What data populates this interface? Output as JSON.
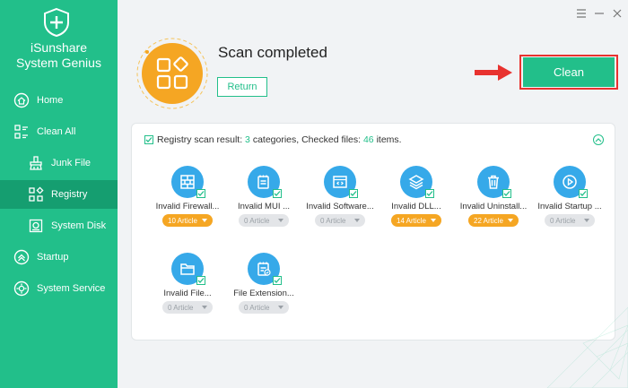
{
  "app": {
    "name_line1": "iSunshare",
    "name_line2": "System Genius"
  },
  "sidebar": {
    "items": [
      {
        "label": "Home",
        "icon": "home-icon"
      },
      {
        "label": "Clean All",
        "icon": "clean-all-icon"
      },
      {
        "label": "Junk File",
        "icon": "junk-file-icon"
      },
      {
        "label": "Registry",
        "icon": "registry-icon",
        "active": true
      },
      {
        "label": "System Disk",
        "icon": "system-disk-icon"
      },
      {
        "label": "Startup",
        "icon": "startup-icon"
      },
      {
        "label": "System Service",
        "icon": "system-service-icon"
      }
    ]
  },
  "header": {
    "title": "Scan completed",
    "return_label": "Return",
    "clean_label": "Clean"
  },
  "result": {
    "prefix": "Registry scan result:",
    "categories_count": "3",
    "categories_text": "categories, Checked files:",
    "files_count": "46",
    "files_text": "items."
  },
  "categories": [
    {
      "label": "Invalid Firewall...",
      "count": "10 Article",
      "state": "found",
      "icon": "firewall-icon"
    },
    {
      "label": "Invalid MUI ...",
      "count": "0 Article",
      "state": "empty",
      "icon": "notepad-icon"
    },
    {
      "label": "Invalid Software...",
      "count": "0 Article",
      "state": "empty",
      "icon": "software-window-icon"
    },
    {
      "label": "Invalid DLL...",
      "count": "14 Article",
      "state": "found",
      "icon": "dll-layers-icon"
    },
    {
      "label": "Invalid Uninstall...",
      "count": "22 Article",
      "state": "found",
      "icon": "trash-icon"
    },
    {
      "label": "Invalid Startup ...",
      "count": "0 Article",
      "state": "empty",
      "icon": "play-icon"
    },
    {
      "label": "Invalid File...",
      "count": "0 Article",
      "state": "empty",
      "icon": "folder-icon"
    },
    {
      "label": "File Extension...",
      "count": "0 Article",
      "state": "empty",
      "icon": "file-extension-icon"
    }
  ],
  "colors": {
    "brand_green": "#22bf8a",
    "active_green": "#159e70",
    "accent_orange": "#f5a623",
    "icon_blue": "#36a9e9",
    "highlight_red": "#e8322f"
  }
}
